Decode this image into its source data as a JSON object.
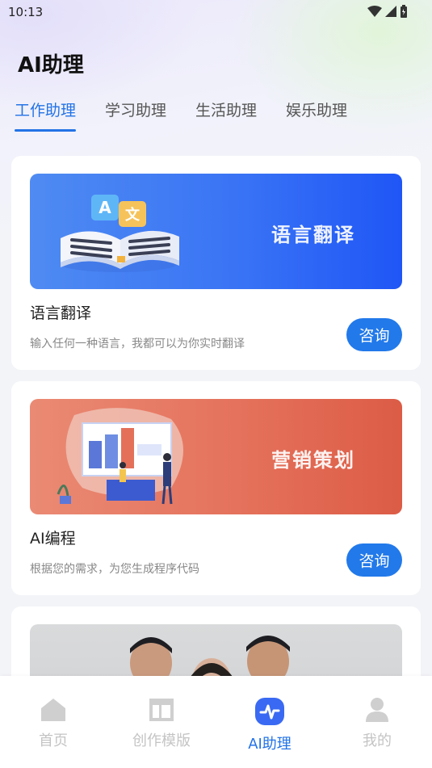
{
  "status": {
    "time": "10:13"
  },
  "page": {
    "title": "AI助理"
  },
  "tabs": [
    {
      "label": "工作助理",
      "active": true
    },
    {
      "label": "学习助理",
      "active": false
    },
    {
      "label": "生活助理",
      "active": false
    },
    {
      "label": "娱乐助理",
      "active": false
    }
  ],
  "cards": [
    {
      "banner_text": "语言翻译",
      "title": "语言翻译",
      "desc": "输入任何一种语言，我都可以为你实时翻译",
      "button": "咨询"
    },
    {
      "banner_text": "营销策划",
      "title": "AI编程",
      "desc": "根据您的需求，为您生成程序代码",
      "button": "咨询"
    }
  ],
  "tabbar": [
    {
      "label": "首页",
      "icon": "home-icon",
      "active": false
    },
    {
      "label": "创作模版",
      "icon": "template-icon",
      "active": false
    },
    {
      "label": "AI助理",
      "icon": "ai-assistant-icon",
      "active": true
    },
    {
      "label": "我的",
      "icon": "profile-icon",
      "active": false
    }
  ],
  "colors": {
    "accent": "#2273e6",
    "button": "#2279ea",
    "inactive": "#c4c4c4"
  }
}
